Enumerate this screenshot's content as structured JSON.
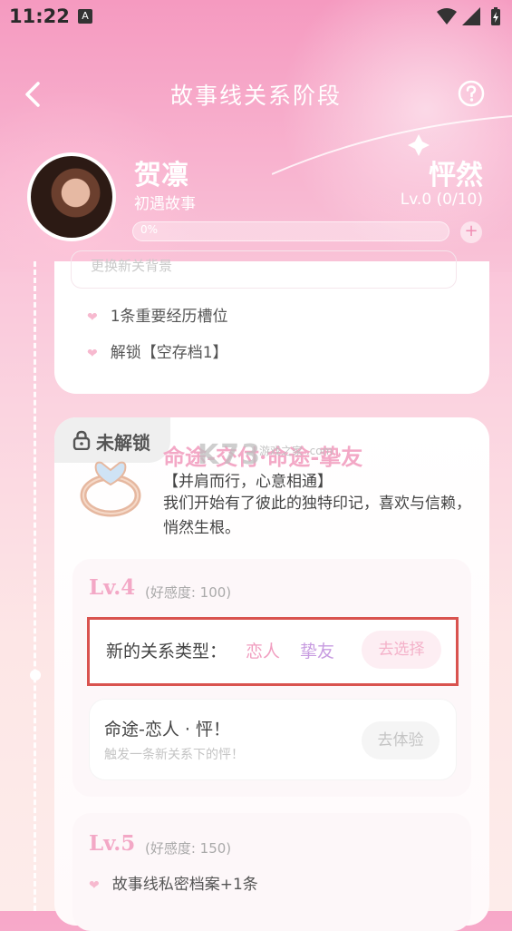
{
  "status_bar": {
    "time": "11:22",
    "app_badge": "A"
  },
  "header": {
    "title": "故事线关系阶段"
  },
  "character": {
    "name": "贺凛",
    "subtitle": "初遇故事",
    "relation": "怦然",
    "level_text": "Lv.0 (0/10)",
    "progress_text": "0%",
    "progress_fraction": 0.0,
    "plus_label": "+"
  },
  "previous_card": {
    "hint": "更换新关背景",
    "bullets": [
      "1条重要经历槽位",
      "解锁【空存档1】"
    ]
  },
  "stage_card": {
    "lock_label": "未解锁",
    "title": "命途-交付·命途-挚友",
    "motto": "【并肩而行，心意相通】",
    "description": "我们开始有了彼此的独特印记，喜欢与信赖，悄然生根。",
    "level4": {
      "label": "Lv.4",
      "affection": "(好感度:  100)",
      "reltype_label": "新的关系类型：",
      "options": [
        "恋人",
        "挚友"
      ],
      "choose_button": "去选择",
      "experience_title": "命途-恋人 · 怦！",
      "experience_sub": "触发一条新关系下的怦！",
      "experience_button": "去体验"
    },
    "level5": {
      "label": "Lv.5",
      "affection": "(好感度:  150)",
      "bullet": "故事线私密档案+1条"
    }
  },
  "watermark": {
    "text": "K73",
    "sub": "游戏之家 .com"
  },
  "colors": {
    "accent_pink": "#f3a8c6",
    "option_pink": "#f19ec0",
    "option_purple": "#c79be0",
    "highlight_red": "#d9534f"
  }
}
